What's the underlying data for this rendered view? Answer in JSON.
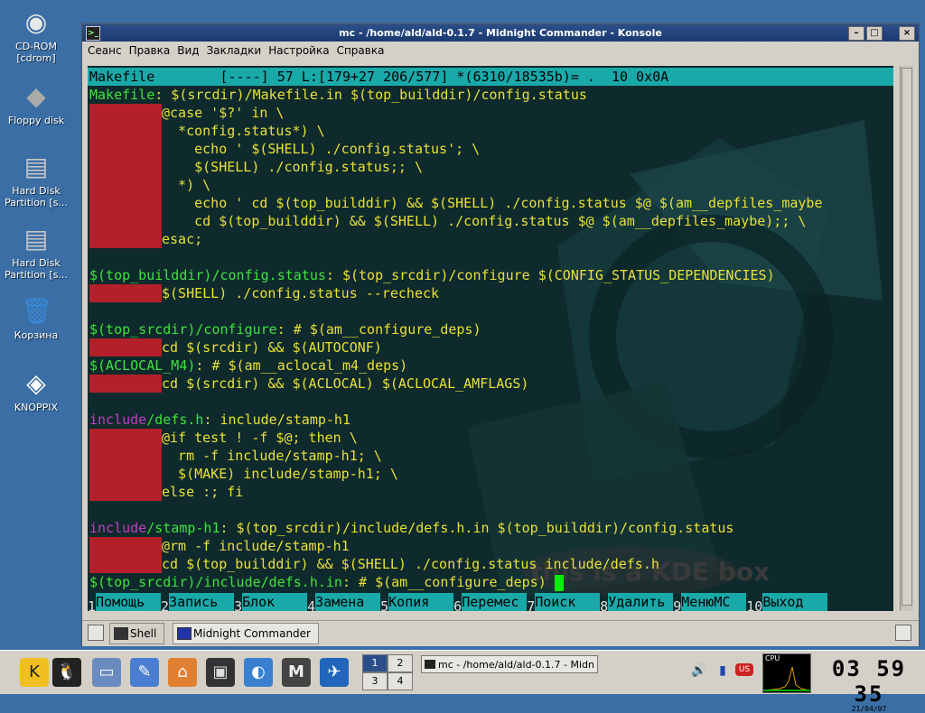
{
  "desktop": {
    "icons": [
      {
        "name": "cd-rom-icon",
        "label": "CD-ROM\n[cdrom]"
      },
      {
        "name": "floppy-disk-icon",
        "label": "Floppy disk"
      },
      {
        "name": "hard-disk-icon",
        "label": "Hard Disk\nPartition [s..."
      },
      {
        "name": "hard-disk-icon",
        "label": "Hard Disk\nPartition [s..."
      },
      {
        "name": "trash-icon",
        "label": "Корзина"
      },
      {
        "name": "knoppix-icon",
        "label": "KNOPPIX"
      }
    ]
  },
  "window": {
    "title": "mc - /home/ald/ald-0.1.7 - Midnight Commander - Konsole",
    "menu": [
      "Сеанс",
      "Правка",
      "Вид",
      "Закладки",
      "Настройка",
      "Справка"
    ]
  },
  "editor": {
    "status": "Makefile        [----] 57 L:[179+27 206/577] *(6310/18535b)= .  10 0x0A",
    "lines": [
      [
        {
          "t": "Makefile",
          "c": "g"
        },
        {
          "t": ": $(srcdir)/Makefile.in $(top_builddir)/config.status"
        }
      ],
      [
        {
          "tab": 1
        },
        {
          "t": "@case '$?' in \\"
        }
      ],
      [
        {
          "tab": 1
        },
        {
          "t": "  *config.status*) \\"
        }
      ],
      [
        {
          "tab": 1
        },
        {
          "t": "    echo ' $(SHELL) ./config.status'; \\"
        }
      ],
      [
        {
          "tab": 1
        },
        {
          "t": "    $(SHELL) ./config.status;; \\"
        }
      ],
      [
        {
          "tab": 1
        },
        {
          "t": "  *) \\"
        }
      ],
      [
        {
          "tab": 1
        },
        {
          "t": "    echo ' cd $(top_builddir) && $(SHELL) ./config.status $@ $(am__depfiles_maybe"
        }
      ],
      [
        {
          "tab": 1
        },
        {
          "t": "    cd $(top_builddir) && $(SHELL) ./config.status $@ $(am__depfiles_maybe);; \\"
        }
      ],
      [
        {
          "tab": 1
        },
        {
          "t": "esac;"
        }
      ],
      [],
      [
        {
          "t": "$(top_builddir)/config.status",
          "c": "g"
        },
        {
          "t": ": $(top_srcdir)/configure $(CONFIG_STATUS_DEPENDENCIES)"
        }
      ],
      [
        {
          "tab": 1
        },
        {
          "t": "$(SHELL) ./config.status --recheck"
        }
      ],
      [],
      [
        {
          "t": "$(top_srcdir)/configure",
          "c": "g"
        },
        {
          "t": ": # $(am__configure_deps)"
        }
      ],
      [
        {
          "tab": 1
        },
        {
          "t": "cd $(srcdir) && $(AUTOCONF)"
        }
      ],
      [
        {
          "t": "$(ACLOCAL_M4)",
          "c": "g"
        },
        {
          "t": ": # $(am__aclocal_m4_deps)"
        }
      ],
      [
        {
          "tab": 1
        },
        {
          "t": "cd $(srcdir) && $(ACLOCAL) $(ACLOCAL_AMFLAGS)"
        }
      ],
      [],
      [
        {
          "t": "include",
          "c": "m"
        },
        {
          "t": "/defs.h",
          "c": "g"
        },
        {
          "t": ": include/stamp-h1"
        }
      ],
      [
        {
          "tab": 1
        },
        {
          "t": "@if test ! -f $@; then \\"
        }
      ],
      [
        {
          "tab": 1
        },
        {
          "t": "  rm -f include/stamp-h1; \\"
        }
      ],
      [
        {
          "tab": 1
        },
        {
          "t": "  $(MAKE) include/stamp-h1; \\"
        }
      ],
      [
        {
          "tab": 1
        },
        {
          "t": "else :; fi"
        }
      ],
      [],
      [
        {
          "t": "include",
          "c": "m"
        },
        {
          "t": "/stamp-h1",
          "c": "g"
        },
        {
          "t": ": $(top_srcdir)/include/defs.h.in $(top_builddir)/config.status"
        }
      ],
      [
        {
          "tab": 1
        },
        {
          "t": "@rm -f include/stamp-h1"
        }
      ],
      [
        {
          "tab": 1
        },
        {
          "t": "cd $(top_builddir) && $(SHELL) ./config.status include/defs.h"
        }
      ],
      [
        {
          "t": "$(top_srcdir)/include/defs.h.in",
          "c": "g"
        },
        {
          "t": ": # $(am__configure_deps) "
        },
        {
          "cursor": 1
        }
      ]
    ],
    "fkeys": [
      {
        "num": "1",
        "name": "Помощь"
      },
      {
        "num": "2",
        "name": "Запись"
      },
      {
        "num": "3",
        "name": "Блок"
      },
      {
        "num": "4",
        "name": "Замена"
      },
      {
        "num": "5",
        "name": "Копия"
      },
      {
        "num": "6",
        "name": "Перемес"
      },
      {
        "num": "7",
        "name": "Поиск"
      },
      {
        "num": "8",
        "name": "Удалить"
      },
      {
        "num": "9",
        "name": "МенюMC"
      },
      {
        "num": "10",
        "name": "Выход"
      }
    ],
    "watermark": "this is a KDE box"
  },
  "tabs": [
    "Shell",
    "Midnight Commander"
  ],
  "taskbar": {
    "pager": [
      "1",
      "2",
      "3",
      "4"
    ],
    "task_title": "mc - /home/ald/ald-0.1.7 - Midn",
    "cpu_label": "CPU",
    "time": "03 59 35",
    "date": "21/04/07"
  }
}
